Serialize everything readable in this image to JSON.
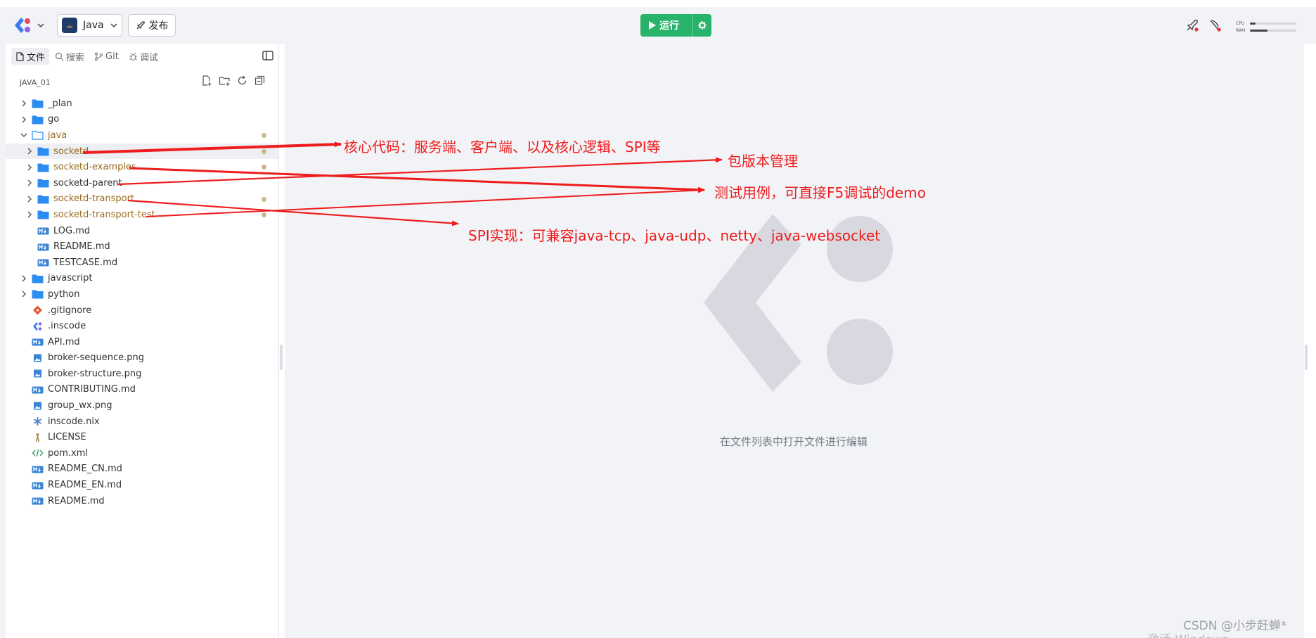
{
  "topbar": {
    "language": "Java",
    "publish_label": "发布",
    "run_label": "运行",
    "perf": {
      "cpu_label": "CPU",
      "ram_label": "RAM",
      "cpu_level": 0.12,
      "ram_level": 0.38
    }
  },
  "sidebar": {
    "tabs": [
      {
        "label": "文件",
        "icon": "file-icon",
        "active": true
      },
      {
        "label": "搜索",
        "icon": "search-icon",
        "active": false
      },
      {
        "label": "Git",
        "icon": "git-branch-icon",
        "active": false
      },
      {
        "label": "调试",
        "icon": "bug-icon",
        "active": false
      }
    ],
    "project_name": "JAVA_01",
    "tree": [
      {
        "label": "_plan",
        "type": "folder",
        "level": 0,
        "expanded": false,
        "modified": false
      },
      {
        "label": "go",
        "type": "folder",
        "level": 0,
        "expanded": false,
        "modified": false
      },
      {
        "label": "java",
        "type": "folder",
        "level": 0,
        "expanded": true,
        "modified": true
      },
      {
        "label": "socketd",
        "type": "folder",
        "level": 1,
        "expanded": false,
        "modified": true,
        "selected": true
      },
      {
        "label": "socketd-examples",
        "type": "folder",
        "level": 1,
        "expanded": false,
        "modified": true
      },
      {
        "label": "socketd-parent",
        "type": "folder",
        "level": 1,
        "expanded": false,
        "modified": false
      },
      {
        "label": "socketd-transport",
        "type": "folder",
        "level": 1,
        "expanded": false,
        "modified": true
      },
      {
        "label": "socketd-transport-test",
        "type": "folder",
        "level": 1,
        "expanded": false,
        "modified": true
      },
      {
        "label": "LOG.md",
        "type": "md",
        "level": 1
      },
      {
        "label": "README.md",
        "type": "md",
        "level": 1
      },
      {
        "label": "TESTCASE.md",
        "type": "md",
        "level": 1
      },
      {
        "label": "javascript",
        "type": "folder",
        "level": 0,
        "expanded": false
      },
      {
        "label": "python",
        "type": "folder",
        "level": 0,
        "expanded": false
      },
      {
        "label": ".gitignore",
        "type": "git",
        "level": 0
      },
      {
        "label": ".inscode",
        "type": "inscode",
        "level": 0
      },
      {
        "label": "API.md",
        "type": "md",
        "level": 0
      },
      {
        "label": "broker-sequence.png",
        "type": "image",
        "level": 0
      },
      {
        "label": "broker-structure.png",
        "type": "image",
        "level": 0
      },
      {
        "label": "CONTRIBUTING.md",
        "type": "md",
        "level": 0
      },
      {
        "label": "group_wx.png",
        "type": "image",
        "level": 0
      },
      {
        "label": "inscode.nix",
        "type": "nix",
        "level": 0
      },
      {
        "label": "LICENSE",
        "type": "license",
        "level": 0
      },
      {
        "label": "pom.xml",
        "type": "xml",
        "level": 0
      },
      {
        "label": "README_CN.md",
        "type": "md",
        "level": 0
      },
      {
        "label": "README_EN.md",
        "type": "md",
        "level": 0
      },
      {
        "label": "README.md",
        "type": "md",
        "level": 0
      }
    ]
  },
  "editor": {
    "empty_hint": "在文件列表中打开文件进行编辑"
  },
  "annotations": {
    "core": "核心代码：服务端、客户端、以及核心逻辑、SPI等",
    "version": "包版本管理",
    "tests": "测试用例，可直接F5调试的demo",
    "spi": "SPI实现：可兼容java-tcp、java-udp、netty、java-websocket"
  },
  "overlay": {
    "csdn": "CSDN @小步赶蝉*",
    "windows_activation": "激活 Windows"
  },
  "colors": {
    "accent_green": "#27b36a",
    "annotation_red": "#ee1c1c",
    "folder_blue": "#2d8cf0",
    "modified_text": "#9a6b1e"
  }
}
